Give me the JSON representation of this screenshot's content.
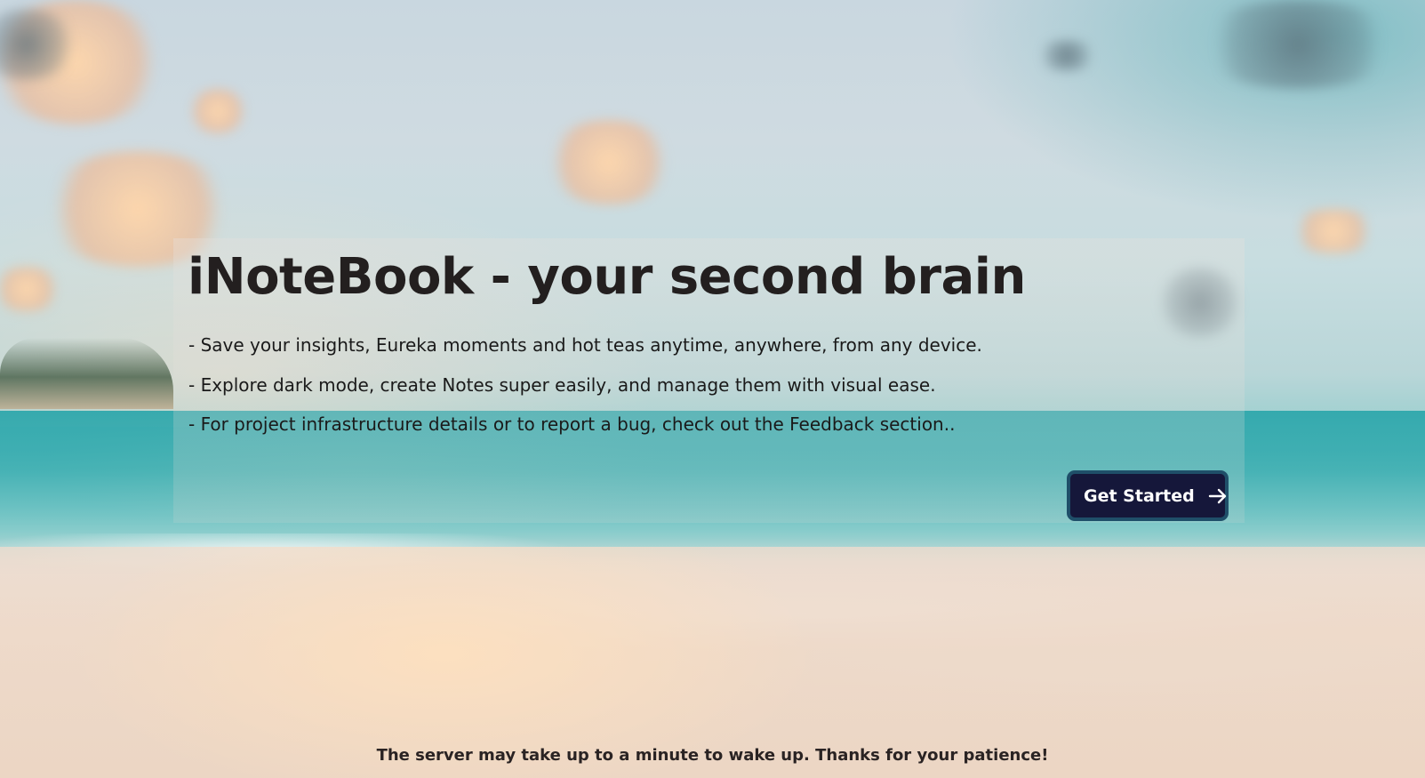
{
  "hero": {
    "title": "iNoteBook - your second brain",
    "features": [
      "- Save your insights, Eureka moments and hot teas anytime, anywhere, from any device.",
      "- Explore dark mode, create Notes super easily, and manage them with visual ease.",
      "- For project infrastructure details or to report a bug, check out the Feedback section.."
    ]
  },
  "cta": {
    "label": "Get Started",
    "icon": "arrow-right-icon"
  },
  "footer": {
    "note": "The server may take up to a minute to wake up. Thanks for your patience!"
  },
  "colors": {
    "cta_background": "#15173a",
    "cta_border": "#1f4f69",
    "title_text": "#231f1f"
  }
}
